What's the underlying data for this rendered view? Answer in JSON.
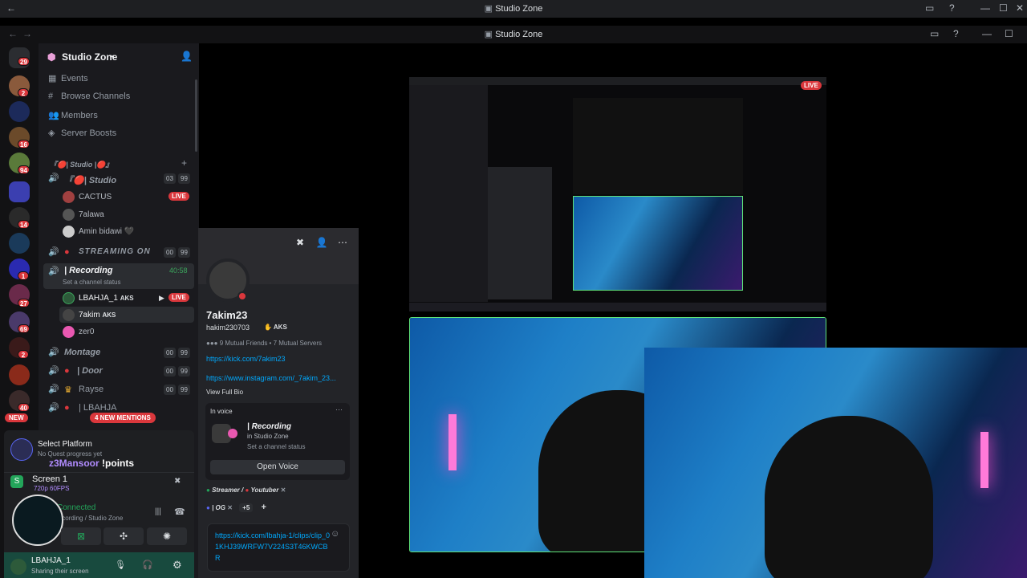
{
  "window": {
    "title": "Studio Zone",
    "inner_title": "Studio Zone"
  },
  "rail_badges": [
    "29",
    "2",
    "16",
    "94",
    "14",
    "1",
    "69",
    "2",
    "NEW",
    "27",
    "2",
    "40"
  ],
  "server": {
    "name": "Studio Zone",
    "nav": [
      {
        "label": "Events",
        "icon": "calendar-icon"
      },
      {
        "label": "Browse Channels",
        "icon": "browse-icon"
      },
      {
        "label": "Members",
        "icon": "members-icon"
      },
      {
        "label": "Server Boosts",
        "icon": "boost-icon"
      }
    ],
    "category": "『🔴| Studio |🔴』",
    "channels": {
      "studio": {
        "name": "『🔴| Studio",
        "count_a": "03",
        "count_b": "99"
      },
      "streaming": {
        "name": "STREAMING ON",
        "count_a": "00",
        "count_b": "99"
      },
      "recording": {
        "name": "| Recording",
        "time": "40:58",
        "status": "Set a channel status"
      },
      "montage": {
        "name": "Montage",
        "count_a": "00",
        "count_b": "99"
      },
      "door": {
        "name": "| Door",
        "count_a": "00",
        "count_b": "99"
      },
      "rayse": {
        "name": "Rayse",
        "count_a": "00",
        "count_b": "99"
      },
      "lbahja": {
        "name": "| LBAHJA"
      }
    },
    "studio_users": [
      "CACTUS",
      "7alawa",
      "Amin bidawi 🖤"
    ],
    "recording_users": [
      {
        "name": "LBAHJA_1",
        "tag": "AKS"
      },
      {
        "name": "7akim",
        "tag": "AKS"
      },
      {
        "name": "zer0"
      }
    ],
    "live_label": "LIVE",
    "mentions": "4 NEW MENTIONS"
  },
  "quest": {
    "title": "Select Platform",
    "sub": "No Quest progress yet"
  },
  "chat_overlay": {
    "user": "z3Mansoor",
    "text": "!points"
  },
  "screen_share": {
    "title": "Screen 1",
    "quality": "720p 60FPS"
  },
  "voice": {
    "status": "Connected",
    "channel": "Recording / Studio Zone"
  },
  "user_panel": {
    "name": "LBAHJA_1",
    "status": "Sharing their screen"
  },
  "profile": {
    "display_name": "7akim23",
    "username": "hakim230703",
    "tag": "AKS",
    "mutual": "9 Mutual Friends • 7 Mutual Servers",
    "link1": "https://kick.com/7akim23",
    "link2": "https://www.instagram.com/_7akim_23...",
    "view_bio": "View Full Bio",
    "in_voice": "In voice",
    "voice_channel": "| Recording",
    "voice_server": "in Studio Zone",
    "voice_status": "Set a channel status",
    "open_voice": "Open Voice",
    "roles": [
      "Streamer / ",
      "Youtuber",
      "| OG"
    ],
    "more_roles": "+5",
    "message": "https://kick.com/lbahja-1/clips/clip_01KHJ39WRFW7V224S3T46KWCBR"
  },
  "stream": {
    "live": "LIVE"
  }
}
